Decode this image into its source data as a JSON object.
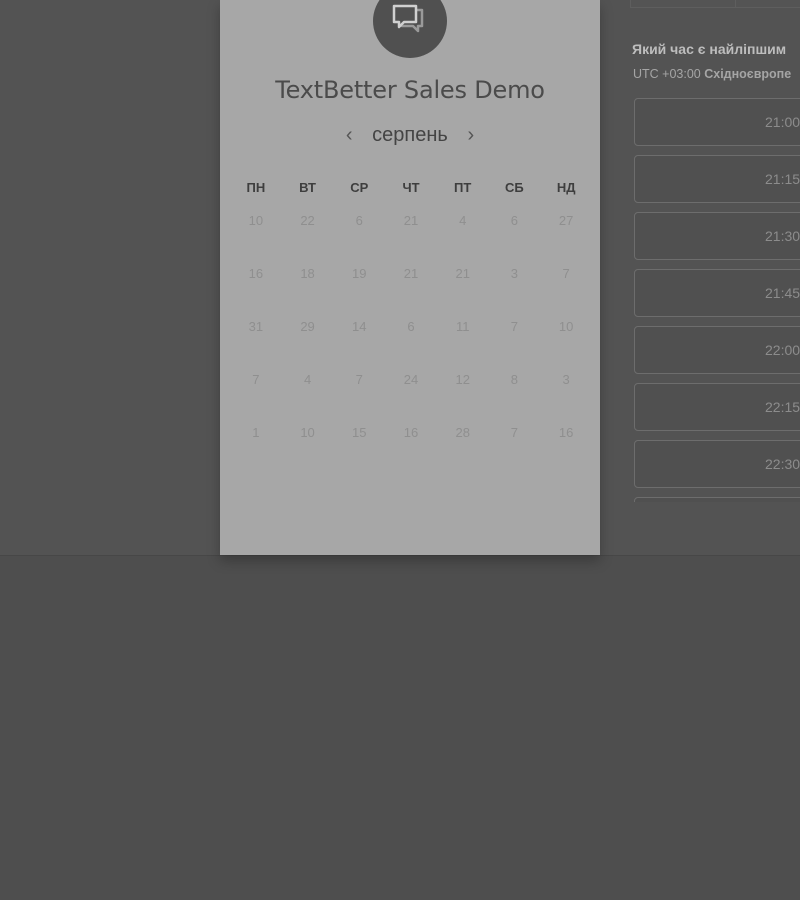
{
  "event": {
    "title": "TextBetter Sales Demo",
    "logo_icon": "chat-bubble-icon"
  },
  "calendar": {
    "month": "серпень",
    "prev_icon": "‹",
    "next_icon": "›",
    "weekdays": [
      "ПН",
      "ВТ",
      "СР",
      "ЧТ",
      "ПТ",
      "СБ",
      "НД"
    ],
    "weeks": [
      [
        "10",
        "22",
        "6",
        "21",
        "4",
        "6",
        "27"
      ],
      [
        "16",
        "18",
        "19",
        "21",
        "21",
        "3",
        "7"
      ],
      [
        "31",
        "29",
        "14",
        "6",
        "11",
        "7",
        "10"
      ],
      [
        "7",
        "4",
        "7",
        "24",
        "12",
        "8",
        "3"
      ],
      [
        "1",
        "10",
        "15",
        "16",
        "28",
        "7",
        "16"
      ]
    ]
  },
  "times": {
    "question": "Який час є найліпшим",
    "timezone_prefix": "UTC +03:00",
    "timezone_name": "Східноєвропе",
    "slots": [
      "21:00",
      "21:15",
      "21:30",
      "21:45",
      "22:00",
      "22:15",
      "22:30",
      ""
    ]
  },
  "colors": {
    "overlay": "#4e4e4e",
    "card": "#a7a7a7",
    "logo_bg": "#505050"
  }
}
